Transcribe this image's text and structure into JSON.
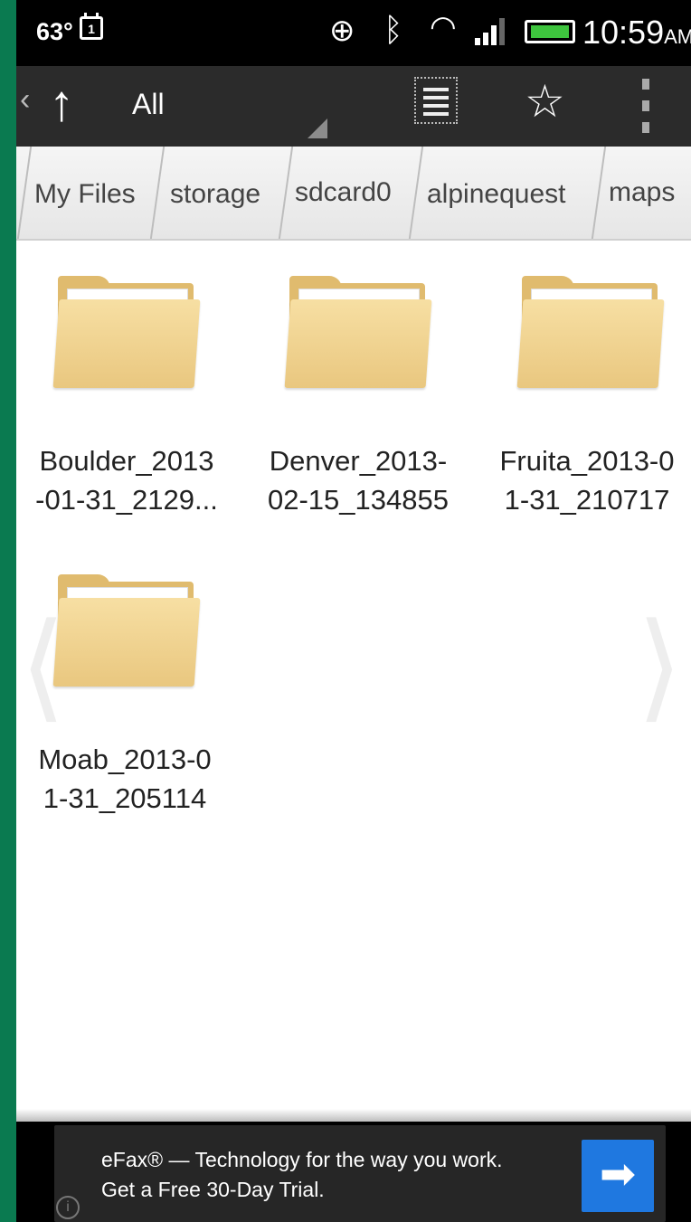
{
  "status_bar": {
    "temperature": "63°",
    "calendar_day": "1",
    "time": "10:59",
    "ampm": "AM"
  },
  "action_bar": {
    "title": "All"
  },
  "breadcrumb": [
    "My Files",
    "storage",
    "sdcard0",
    "alpinequest",
    "maps"
  ],
  "folders": [
    {
      "line1": "Boulder_2013",
      "line2": "-01-31_2129..."
    },
    {
      "line1": "Denver_2013-",
      "line2": "02-15_134855"
    },
    {
      "line1": "Fruita_2013-0",
      "line2": "1-31_210717"
    },
    {
      "line1": "Moab_2013-0",
      "line2": "1-31_205114"
    }
  ],
  "ad": {
    "text": "eFax® — Technology for the way you work. Get a Free 30-Day Trial."
  },
  "colors": {
    "frame_border": "#0a7a50",
    "action_bar": "#2b2b2b",
    "folder": "#e9c77f",
    "ad_button": "#1f78e0"
  }
}
